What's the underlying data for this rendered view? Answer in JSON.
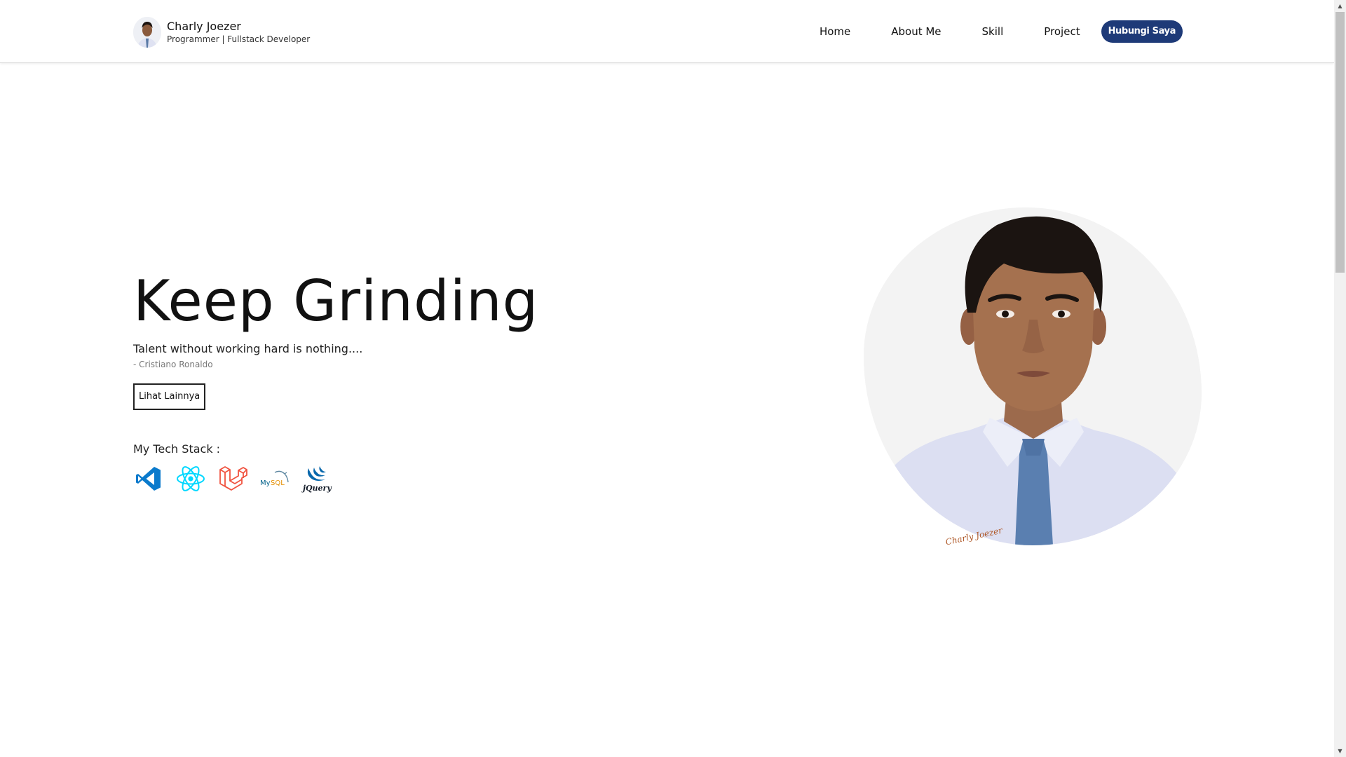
{
  "header": {
    "name": "Charly Joezer",
    "role": "Programmer | Fullstack Developer",
    "nav": [
      "Home",
      "About Me",
      "Skill",
      "Project"
    ],
    "cta": "Hubungi Saya"
  },
  "hero": {
    "title": "Keep Grinding",
    "quote": "Talent without working hard is nothing....",
    "author": "- Cristiano Ronaldo",
    "button": "Lihat Lainnya",
    "stack_label": "My Tech Stack :",
    "stack_icons": [
      "vscode-icon",
      "react-icon",
      "laravel-icon",
      "mysql-icon",
      "jquery-icon"
    ]
  },
  "portrait": {
    "signature": "Charly Joezer"
  },
  "colors": {
    "accent": "#1e3a78",
    "vscode": "#0a7acc",
    "react": "#00d8ff",
    "laravel": "#f05340",
    "jquery": "#0868ac"
  }
}
